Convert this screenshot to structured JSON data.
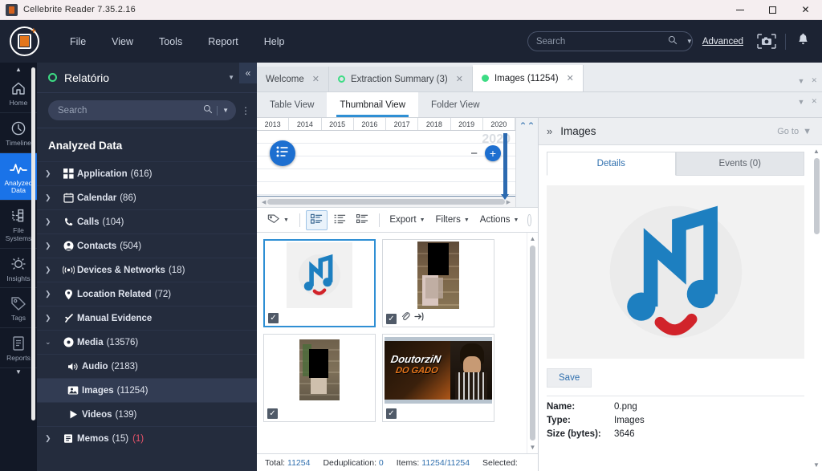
{
  "window": {
    "title": "Cellebrite Reader 7.35.2.16",
    "minimize_label": "Minimize",
    "maximize_label": "Maximize",
    "close_label": "Close"
  },
  "menubar": {
    "items": [
      "File",
      "View",
      "Tools",
      "Report",
      "Help"
    ],
    "search_placeholder": "Search",
    "search_value": "",
    "advanced_label": "Advanced",
    "snapshot_icon": "camera-icon",
    "bell_icon": "bell-icon"
  },
  "rail": {
    "items": [
      {
        "label": "Home",
        "icon": "home-icon",
        "active": false
      },
      {
        "label": "Timeline",
        "icon": "clock-icon",
        "active": false
      },
      {
        "label": "Analyzed\nData",
        "icon": "pulse-icon",
        "active": true
      },
      {
        "label": "File\nSystems",
        "icon": "file-systems-icon",
        "active": false
      },
      {
        "label": "Insights",
        "icon": "lightbulb-icon",
        "active": false
      },
      {
        "label": "Tags",
        "icon": "tag-icon",
        "active": false
      },
      {
        "label": "Reports",
        "icon": "report-icon",
        "active": false
      }
    ]
  },
  "tree_panel": {
    "title": "Relatório",
    "status_icon": "green-circle-icon",
    "collapse_label": "«",
    "search_placeholder": "Search",
    "search_value": "",
    "section_title": "Analyzed Data",
    "nodes": [
      {
        "label": "Application",
        "count": "(616)",
        "icon": "apps-icon",
        "arrow": "›",
        "indent": 0,
        "selected": false
      },
      {
        "label": "Calendar",
        "count": "(86)",
        "icon": "calendar-icon",
        "arrow": "›",
        "indent": 0,
        "selected": false
      },
      {
        "label": "Calls",
        "count": "(104)",
        "icon": "phone-icon",
        "arrow": "›",
        "indent": 0,
        "selected": false
      },
      {
        "label": "Contacts",
        "count": "(504)",
        "icon": "contact-icon",
        "arrow": "›",
        "indent": 0,
        "selected": false
      },
      {
        "label": "Devices & Networks",
        "count": "(18)",
        "icon": "network-icon",
        "arrow": "›",
        "indent": 0,
        "selected": false
      },
      {
        "label": "Location Related",
        "count": "(72)",
        "icon": "pin-icon",
        "arrow": "›",
        "indent": 0,
        "selected": false
      },
      {
        "label": "Manual Evidence",
        "count": "",
        "icon": "wrench-icon",
        "arrow": "›",
        "indent": 0,
        "selected": false
      },
      {
        "label": "Media",
        "count": "(13576)",
        "icon": "media-icon",
        "arrow": "⌄",
        "indent": 0,
        "selected": false
      },
      {
        "label": "Audio",
        "count": "(2183)",
        "icon": "speaker-icon",
        "arrow": "",
        "indent": 1,
        "selected": false
      },
      {
        "label": "Images",
        "count": "(11254)",
        "icon": "image-icon",
        "arrow": "",
        "indent": 1,
        "selected": true
      },
      {
        "label": "Videos",
        "count": "(139)",
        "icon": "play-icon",
        "arrow": "",
        "indent": 1,
        "selected": false
      },
      {
        "label": "Memos",
        "count": "(15)",
        "badge": "(1)",
        "icon": "memo-icon",
        "arrow": "›",
        "indent": 0,
        "selected": false
      }
    ]
  },
  "tabs": [
    {
      "label": "Welcome",
      "dot": "none",
      "active": false,
      "closable": true
    },
    {
      "label": "Extraction Summary (3)",
      "dot": "outline",
      "active": false,
      "closable": true
    },
    {
      "label": "Images (11254)",
      "dot": "filled",
      "active": true,
      "closable": true
    }
  ],
  "subtabs": [
    {
      "label": "Table View",
      "active": false
    },
    {
      "label": "Thumbnail View",
      "active": true
    },
    {
      "label": "Folder View",
      "active": false
    }
  ],
  "timeline": {
    "years": [
      "2013",
      "2014",
      "2015",
      "2016",
      "2017",
      "2018",
      "2019",
      "2020"
    ],
    "highlight_year": "2020",
    "list_icon": "list-icon",
    "zoom_out_label": "−",
    "zoom_in_label": "+",
    "collapse_icon": "chevron-up-icon"
  },
  "chart_data": {
    "type": "bar",
    "title": "",
    "xlabel": "",
    "ylabel": "",
    "categories": [
      "2013",
      "2014",
      "2015",
      "2016",
      "2017",
      "2018",
      "2019",
      "2020"
    ],
    "values": [
      0,
      0,
      0,
      0,
      0,
      0,
      0,
      100
    ],
    "ylim": [
      0,
      100
    ],
    "grid": true,
    "legend": "none",
    "annotations": [
      "2020"
    ]
  },
  "content_toolbar": {
    "tag_icon": "tag-icon",
    "view_icons": [
      "list-detail-icon",
      "list-tree-icon",
      "list-compact-icon"
    ],
    "buttons": [
      "Export",
      "Filters",
      "Actions"
    ]
  },
  "thumbnails": [
    {
      "name": "0.png",
      "kind": "music-note-logo",
      "selected": true,
      "checked": true,
      "icons": []
    },
    {
      "name": "",
      "kind": "photo-censored-tall",
      "selected": false,
      "checked": true,
      "icons": [
        "paperclip-icon",
        "open-in-icon"
      ]
    },
    {
      "name": "",
      "kind": "photo-censored-wall",
      "selected": false,
      "checked": true,
      "icons": []
    },
    {
      "name": "",
      "kind": "poster-doutorzin",
      "selected": false,
      "checked": true,
      "icons": [],
      "poster_text_1": "DoutorziN",
      "poster_text_2": "DO GADO"
    }
  ],
  "statusbar": {
    "total_label": "Total:",
    "total_value": "11254",
    "dedup_label": "Deduplication:",
    "dedup_value": "0",
    "items_label": "Items:",
    "items_value": "11254/11254",
    "selected_label": "Selected:",
    "selected_value": ""
  },
  "details_pane": {
    "title": "Images",
    "expand_icon": "chevrons-right-icon",
    "goto_label": "Go to",
    "tabs": [
      {
        "label": "Details",
        "active": true
      },
      {
        "label": "Events (0)",
        "active": false
      }
    ],
    "save_label": "Save",
    "fields": [
      {
        "key": "Name:",
        "value": "0.png"
      },
      {
        "key": "Type:",
        "value": "Images"
      },
      {
        "key": "Size (bytes):",
        "value": "3646"
      }
    ]
  },
  "colors": {
    "accent_blue": "#1d6fd0",
    "tab_underline": "#2f8fd4",
    "dark_nav": "#1c2333",
    "tree_bg": "#242c3d",
    "green_status": "#3ddc84",
    "badge_red": "#e9536a",
    "note_blue": "#1d7fc0",
    "note_red": "#d1232a"
  }
}
